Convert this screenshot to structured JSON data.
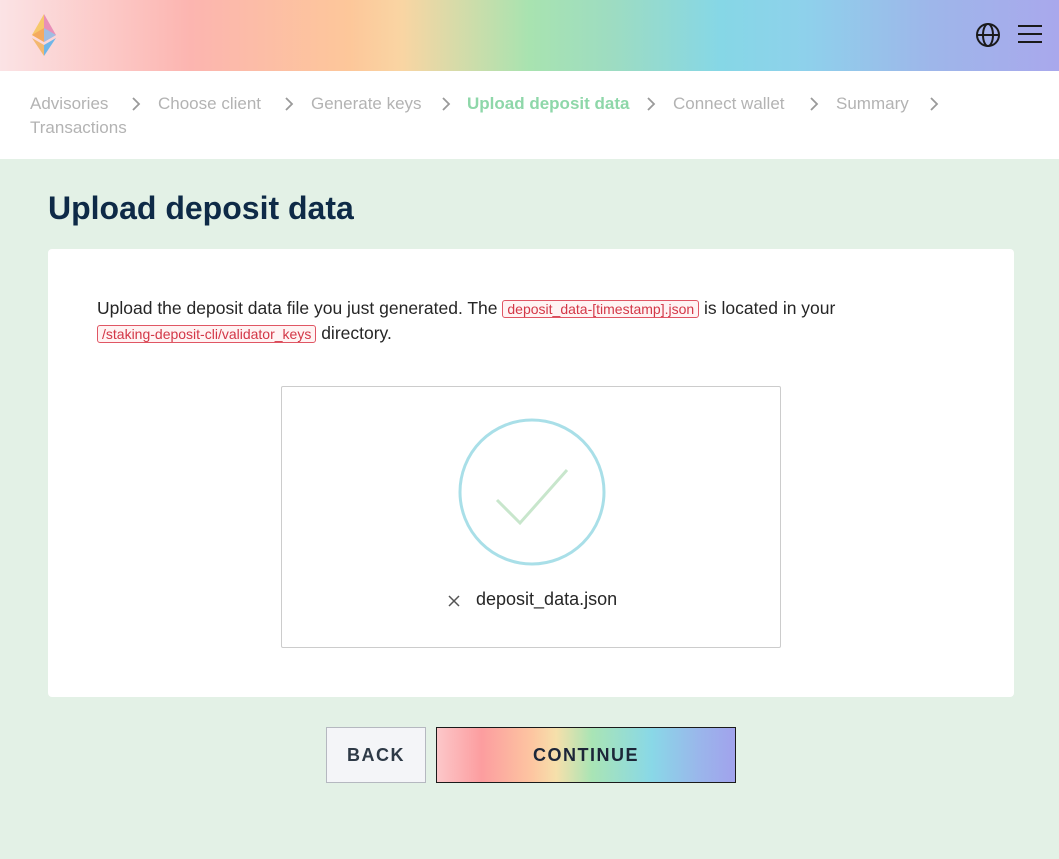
{
  "header": {
    "logo_icon": "ethereum-logo-icon",
    "language_icon": "globe-icon",
    "menu_icon": "hamburger-menu-icon"
  },
  "breadcrumbs": [
    {
      "label": "Advisories",
      "active": false
    },
    {
      "label": "Choose client",
      "active": false
    },
    {
      "label": "Generate keys",
      "active": false
    },
    {
      "label": "Upload deposit data",
      "active": true
    },
    {
      "label": "Connect wallet",
      "active": false
    },
    {
      "label": "Summary",
      "active": false
    },
    {
      "label": "Transactions",
      "active": false
    }
  ],
  "page": {
    "title": "Upload deposit data"
  },
  "card": {
    "desc_part1": "Upload the deposit data file you just generated. The",
    "desc_code1": "deposit_data-[timestamp].json",
    "desc_part2": "is located in your",
    "desc_code2": "/staking-deposit-cli/validator_keys",
    "desc_part3": "directory."
  },
  "upload": {
    "status_icon": "checkmark-circle-icon",
    "remove_icon": "close-icon",
    "file_name": "deposit_data.json"
  },
  "actions": {
    "back_label": "BACK",
    "continue_label": "CONTINUE"
  },
  "colors": {
    "active_crumb": "#8ed7a9",
    "inactive_crumb": "#b3b3b3",
    "title": "#0e2a47",
    "code_text": "#d33747",
    "check_circle": "#a9dfe8",
    "background": "#e3f1e6"
  }
}
